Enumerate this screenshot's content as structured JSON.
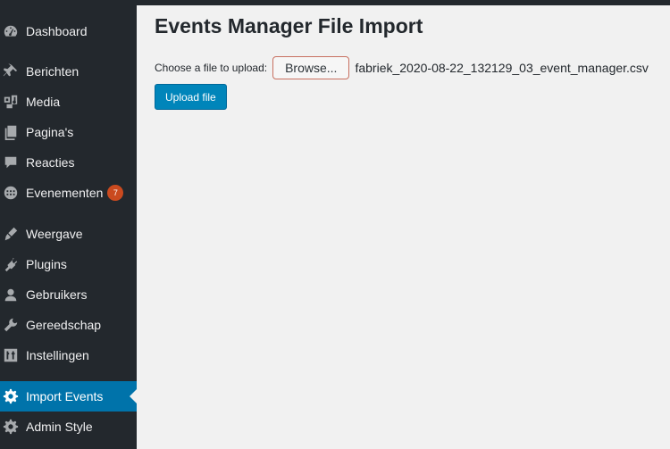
{
  "sidebar": {
    "items": [
      {
        "label": "Dashboard",
        "icon": "dashboard-icon"
      },
      {
        "label": "Berichten",
        "icon": "pin-icon"
      },
      {
        "label": "Media",
        "icon": "media-icon"
      },
      {
        "label": "Pagina's",
        "icon": "pages-icon"
      },
      {
        "label": "Reacties",
        "icon": "comments-icon"
      },
      {
        "label": "Evenementen",
        "icon": "calendar-icon",
        "badge": "7"
      },
      {
        "label": "Weergave",
        "icon": "brush-icon"
      },
      {
        "label": "Plugins",
        "icon": "plugin-icon"
      },
      {
        "label": "Gebruikers",
        "icon": "user-icon"
      },
      {
        "label": "Gereedschap",
        "icon": "wrench-icon"
      },
      {
        "label": "Instellingen",
        "icon": "settings-sliders-icon"
      },
      {
        "label": "Import Events",
        "icon": "gear-icon",
        "active": true
      },
      {
        "label": "Admin Style",
        "icon": "gear-icon"
      }
    ]
  },
  "main": {
    "title": "Events Manager File Import",
    "file_label": "Choose a file to upload:",
    "browse_label": "Browse...",
    "file_name": "fabriek_2020-08-22_132129_03_event_manager.csv",
    "upload_label": "Upload file"
  },
  "colors": {
    "sidebar_bg": "#23282d",
    "active_bg": "#0073aa",
    "badge_bg": "#ca4a1f",
    "button_bg": "#0085ba",
    "content_bg": "#f1f1f1"
  }
}
